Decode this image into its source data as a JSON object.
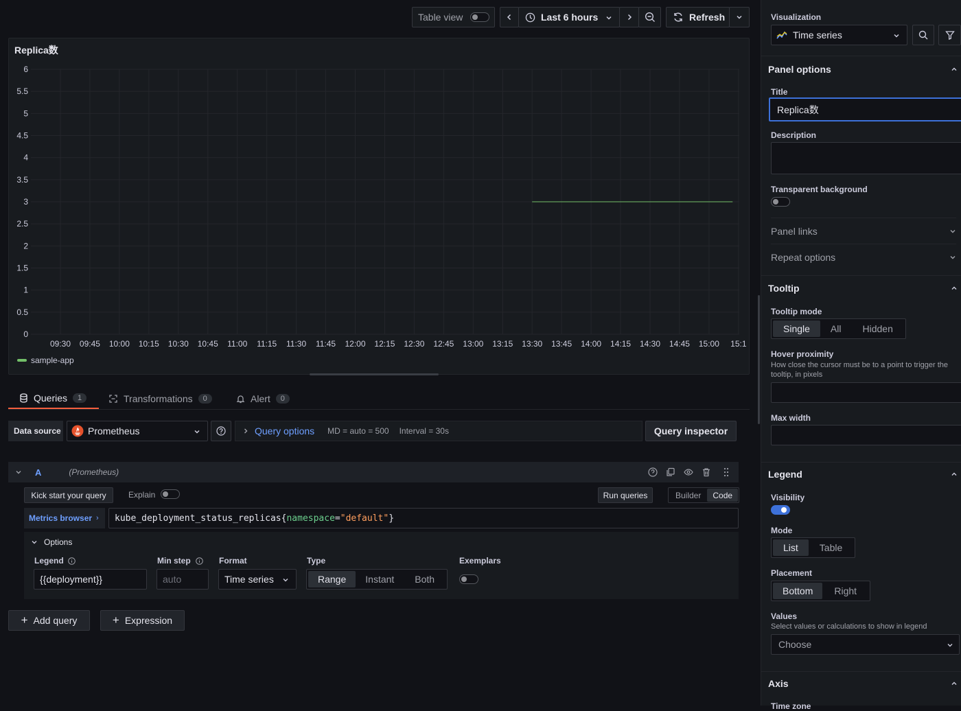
{
  "toolbar": {
    "table_view_label": "Table view",
    "time_range_label": "Last 6 hours",
    "refresh_label": "Refresh"
  },
  "panel": {
    "title": "Replica数"
  },
  "chart_data": {
    "type": "line",
    "title": "Replica数",
    "y_ticks": [
      "6",
      "5.5",
      "5",
      "4.5",
      "4",
      "3.5",
      "3",
      "2.5",
      "2",
      "1.5",
      "1",
      "0.5",
      "0"
    ],
    "x_ticks": [
      "09:30",
      "09:45",
      "10:00",
      "10:15",
      "10:30",
      "10:45",
      "11:00",
      "11:15",
      "11:30",
      "11:45",
      "12:00",
      "12:15",
      "12:30",
      "12:45",
      "13:00",
      "13:15",
      "13:30",
      "13:45",
      "14:00",
      "14:15",
      "14:30",
      "14:45",
      "15:00",
      "15:1"
    ],
    "ylim": [
      0,
      6
    ],
    "grid": true,
    "legend_position": "bottom-left",
    "series": [
      {
        "name": "sample-app",
        "color": "#73bf69",
        "x": [
          "13:30",
          "15:12"
        ],
        "y": [
          3,
          3
        ]
      }
    ]
  },
  "tabs": [
    {
      "label": "Queries",
      "count": "1",
      "active": true
    },
    {
      "label": "Transformations",
      "count": "0"
    },
    {
      "label": "Alert",
      "count": "0"
    }
  ],
  "datasource": {
    "label": "Data source",
    "value": "Prometheus",
    "query_options_label": "Query options",
    "md_info": "MD = auto = 500",
    "interval_info": "Interval = 30s",
    "query_inspector_label": "Query inspector"
  },
  "query": {
    "ref": "A",
    "source": "(Prometheus)",
    "kick_start": "Kick start your query",
    "explain": "Explain",
    "run_queries": "Run queries",
    "builder": "Builder",
    "code": "Code",
    "metrics_browser": "Metrics browser",
    "expr_metric": "kube_deployment_status_replicas",
    "expr_open": "{",
    "expr_label": "namespace",
    "expr_eq": "=",
    "expr_value": "\"default\"",
    "expr_close": "}",
    "options_label": "Options",
    "legend_label": "Legend",
    "legend_value": "{{deployment}}",
    "min_step_label": "Min step",
    "min_step_placeholder": "auto",
    "format_label": "Format",
    "format_value": "Time series",
    "type_label": "Type",
    "type_options": [
      "Range",
      "Instant",
      "Both"
    ],
    "exemplars_label": "Exemplars",
    "add_query": "Add query",
    "expression": "Expression"
  },
  "sidebar": {
    "visualization_label": "Visualization",
    "visualization_value": "Time series",
    "panel_options_label": "Panel options",
    "title_label": "Title",
    "title_value": "Replica数",
    "description_label": "Description",
    "transparent_label": "Transparent background",
    "panel_links_label": "Panel links",
    "repeat_options_label": "Repeat options",
    "tooltip_label": "Tooltip",
    "tooltip_mode_label": "Tooltip mode",
    "tooltip_modes": [
      "Single",
      "All",
      "Hidden"
    ],
    "hover_proximity_label": "Hover proximity",
    "hover_proximity_desc": "How close the cursor must be to a point to trigger the tooltip, in pixels",
    "max_width_label": "Max width",
    "legend_label": "Legend",
    "visibility_label": "Visibility",
    "mode_label": "Mode",
    "modes": [
      "List",
      "Table"
    ],
    "placement_label": "Placement",
    "placements": [
      "Bottom",
      "Right"
    ],
    "values_label": "Values",
    "values_desc": "Select values or calculations to show in legend",
    "values_placeholder": "Choose",
    "axis_label": "Axis",
    "time_zone_label": "Time zone"
  }
}
